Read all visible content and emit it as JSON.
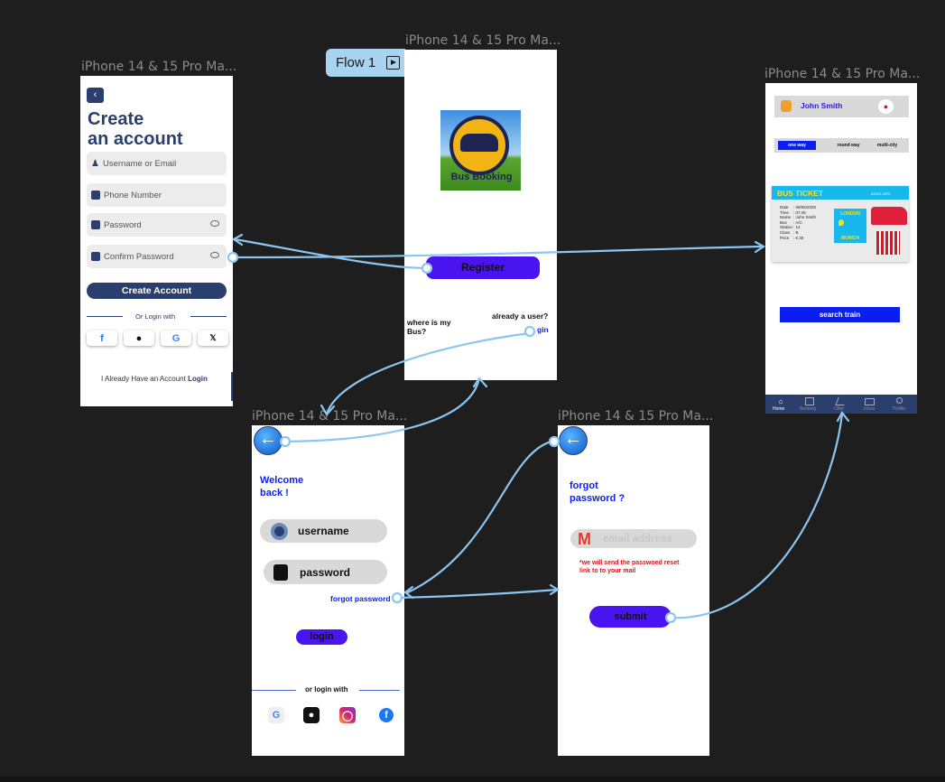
{
  "canvas": {
    "flow_label": "Flow 1",
    "frame_labels": {
      "create_account": "iPhone 14 & 15 Pro Ma...",
      "splash": "iPhone 14 & 15 Pro Ma...",
      "ticket": "iPhone 14 & 15 Pro Ma...",
      "login": "iPhone 14 & 15 Pro Ma...",
      "forgot": "iPhone 14 & 15 Pro Ma..."
    }
  },
  "create_account": {
    "title_line1": "Create",
    "title_line2": "an account",
    "username_placeholder": "Username or Email",
    "phone_placeholder": "Phone Number",
    "password_placeholder": "Password",
    "confirm_placeholder": "Confirm Password",
    "submit": "Create Account",
    "divider": "Or Login with",
    "footer_text": "I Already Have an Account",
    "footer_link": "Login"
  },
  "splash": {
    "logo_text": "Bus Booking",
    "register": "Register",
    "where_is_bus": "where is  my Bus?",
    "already_user": "already a user?",
    "login_link": "gin"
  },
  "ticket": {
    "user_name": "John Smith",
    "tabs": [
      "one way",
      "round way",
      "multi-city"
    ],
    "card_title": "BUS TICKET",
    "card_code": "#2023-1573",
    "details": [
      [
        "Date",
        ": 06/05/2025"
      ],
      [
        "Time",
        ": 07:45"
      ],
      [
        "Name",
        ": John Smith"
      ],
      [
        "Bus",
        ": A/C"
      ],
      [
        "Station",
        ": 14"
      ],
      [
        "Class",
        ": B"
      ],
      [
        "Price",
        ": € 30"
      ]
    ],
    "from_city": "LONDON",
    "to_city": "MUNICH",
    "search_button": "search train",
    "nav": [
      "Home",
      "Booking",
      "Offer",
      "Inbox",
      "Profile"
    ]
  },
  "login": {
    "welcome_line1": "Welcome",
    "welcome_line2": "back !",
    "username": "username",
    "password": "password",
    "forgot": "forgot password",
    "login_button": "login",
    "or_login": "or login with"
  },
  "forgot": {
    "title_line1": "forgot",
    "title_line2": "password ?",
    "email_placeholder": "email address",
    "note": "*we will send the passwoed reset link to to your mail",
    "submit": "submit"
  },
  "colors": {
    "navy": "#2b3f6e",
    "purple": "#4a14f0",
    "blue": "#0a1ef0",
    "connector": "#8cc6f0"
  }
}
